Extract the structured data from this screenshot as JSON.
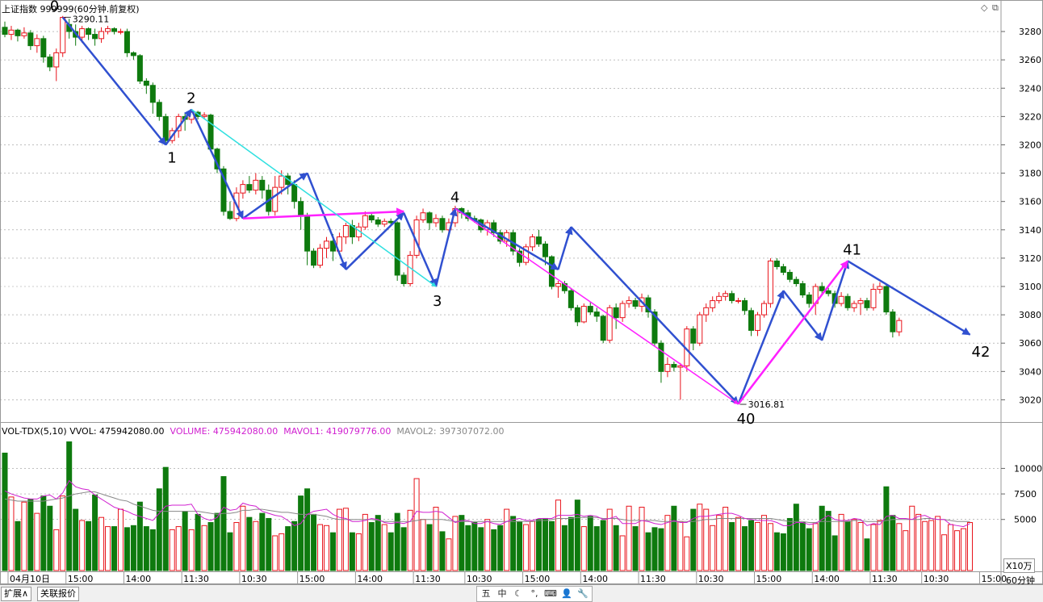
{
  "header": {
    "title": "上证指数",
    "code": "999999(60分钟.前复权)"
  },
  "volume_header": {
    "indicator": "VOL-TDX(5,10)",
    "vvol_label": "VVOL:",
    "vvol_value": "475942080.00",
    "volume_label": "VOLUME:",
    "volume_value": "475942080.00",
    "mavol1_label": "MAVOL1:",
    "mavol1_value": "419079776.00",
    "mavol2_label": "MAVOL2:",
    "mavol2_value": "397307072.00"
  },
  "unit_label": "X10万",
  "period_label": "60分钟",
  "tabs": [
    "扩展∧",
    "关联报价"
  ],
  "tools": [
    "五",
    "中",
    "☾",
    "°,",
    "⌨",
    "👤",
    "🔧"
  ],
  "colors": {
    "up": "#e8141b",
    "down": "#0e7a0e",
    "blue": "#3050d0",
    "magenta": "#ff20ff",
    "cyan": "#30e0e0",
    "mavol1": "#d020d0",
    "mavol2": "#888888"
  },
  "chart_data": {
    "type": "candlestick",
    "price_axis": {
      "ticks": [
        3020,
        3040,
        3060,
        3080,
        3100,
        3120,
        3140,
        3160,
        3180,
        3200,
        3220,
        3240,
        3260,
        3280
      ],
      "range": [
        3006,
        3292
      ]
    },
    "volume_axis": {
      "ticks": [
        5000,
        7500,
        10000
      ],
      "range": [
        0,
        12800
      ]
    },
    "time_labels": [
      {
        "i": 1,
        "t": "04月10日"
      },
      {
        "i": 10,
        "t": "15:00"
      },
      {
        "i": 19,
        "t": "14:00"
      },
      {
        "i": 28,
        "t": "11:30"
      },
      {
        "i": 37,
        "t": "10:30"
      },
      {
        "i": 46,
        "t": "15:00"
      },
      {
        "i": 55,
        "t": "14:00"
      },
      {
        "i": 64,
        "t": "11:30"
      },
      {
        "i": 72,
        "t": "10:30"
      },
      {
        "i": 81,
        "t": "15:00"
      },
      {
        "i": 90,
        "t": "14:00"
      },
      {
        "i": 99,
        "t": "11:30"
      },
      {
        "i": 108,
        "t": "10:30"
      },
      {
        "i": 117,
        "t": "15:00"
      },
      {
        "i": 126,
        "t": "14:00"
      },
      {
        "i": 135,
        "t": "11:30"
      },
      {
        "i": 143,
        "t": "10:30"
      },
      {
        "i": 152,
        "t": "15:00"
      }
    ],
    "candles": [
      [
        3283,
        3278,
        3287,
        3276
      ],
      [
        3278,
        3281,
        3284,
        3274
      ],
      [
        3281,
        3277,
        3282,
        3273
      ],
      [
        3277,
        3279,
        3283,
        3275
      ],
      [
        3279,
        3270,
        3281,
        3267
      ],
      [
        3270,
        3275,
        3278,
        3265
      ],
      [
        3275,
        3262,
        3277,
        3258
      ],
      [
        3262,
        3255,
        3264,
        3252
      ],
      [
        3255,
        3265,
        3268,
        3245
      ],
      [
        3265,
        3290,
        3291,
        3262
      ],
      [
        3285,
        3280,
        3289,
        3275
      ],
      [
        3280,
        3276,
        3285,
        3270
      ],
      [
        3276,
        3282,
        3284,
        3272
      ],
      [
        3282,
        3278,
        3283,
        3274
      ],
      [
        3278,
        3275,
        3282,
        3270
      ],
      [
        3275,
        3280,
        3283,
        3272
      ],
      [
        3280,
        3282,
        3284,
        3278
      ],
      [
        3282,
        3280,
        3283,
        3278
      ],
      [
        3280,
        3280,
        3282,
        3278
      ],
      [
        3280,
        3265,
        3282,
        3262
      ],
      [
        3265,
        3263,
        3266,
        3260
      ],
      [
        3263,
        3245,
        3264,
        3243
      ],
      [
        3245,
        3242,
        3247,
        3236
      ],
      [
        3242,
        3230,
        3244,
        3222
      ],
      [
        3230,
        3220,
        3232,
        3217
      ],
      [
        3220,
        3203,
        3222,
        3200
      ],
      [
        3203,
        3210,
        3212,
        3201
      ],
      [
        3210,
        3220,
        3222,
        3205
      ],
      [
        3220,
        3218,
        3222,
        3210
      ],
      [
        3218,
        3223,
        3225,
        3215
      ],
      [
        3223,
        3220,
        3224,
        3218
      ],
      [
        3220,
        3221,
        3223,
        3218
      ],
      [
        3221,
        3197,
        3222,
        3195
      ],
      [
        3197,
        3183,
        3198,
        3180
      ],
      [
        3183,
        3153,
        3185,
        3150
      ],
      [
        3153,
        3148,
        3160,
        3147
      ],
      [
        3148,
        3166,
        3170,
        3146
      ],
      [
        3166,
        3172,
        3175,
        3162
      ],
      [
        3172,
        3168,
        3178,
        3166
      ],
      [
        3168,
        3175,
        3180,
        3165
      ],
      [
        3175,
        3168,
        3178,
        3162
      ],
      [
        3168,
        3153,
        3172,
        3150
      ],
      [
        3153,
        3170,
        3178,
        3150
      ],
      [
        3170,
        3178,
        3182,
        3165
      ],
      [
        3178,
        3172,
        3180,
        3165
      ],
      [
        3172,
        3160,
        3175,
        3155
      ],
      [
        3160,
        3150,
        3163,
        3140
      ],
      [
        3150,
        3125,
        3152,
        3115
      ],
      [
        3125,
        3115,
        3127,
        3113
      ],
      [
        3115,
        3127,
        3130,
        3113
      ],
      [
        3127,
        3132,
        3135,
        3120
      ],
      [
        3132,
        3125,
        3137,
        3118
      ],
      [
        3125,
        3135,
        3138,
        3122
      ],
      [
        3135,
        3143,
        3145,
        3130
      ],
      [
        3143,
        3135,
        3147,
        3130
      ],
      [
        3135,
        3142,
        3145,
        3132
      ],
      [
        3142,
        3150,
        3153,
        3140
      ],
      [
        3150,
        3147,
        3152,
        3145
      ],
      [
        3147,
        3144,
        3149,
        3142
      ],
      [
        3144,
        3146,
        3148,
        3142
      ],
      [
        3146,
        3145,
        3148,
        3143
      ],
      [
        3145,
        3108,
        3146,
        3104
      ],
      [
        3108,
        3102,
        3110,
        3100
      ],
      [
        3102,
        3122,
        3125,
        3100
      ],
      [
        3122,
        3147,
        3150,
        3120
      ],
      [
        3147,
        3152,
        3155,
        3145
      ],
      [
        3152,
        3145,
        3153,
        3140
      ],
      [
        3145,
        3148,
        3151,
        3142
      ],
      [
        3148,
        3140,
        3150,
        3138
      ],
      [
        3140,
        3145,
        3148,
        3135
      ],
      [
        3145,
        3155,
        3157,
        3142
      ],
      [
        3155,
        3152,
        3156,
        3148
      ],
      [
        3152,
        3148,
        3154,
        3146
      ],
      [
        3148,
        3147,
        3150,
        3145
      ],
      [
        3147,
        3140,
        3148,
        3138
      ],
      [
        3140,
        3145,
        3147,
        3136
      ],
      [
        3145,
        3138,
        3147,
        3135
      ],
      [
        3138,
        3132,
        3140,
        3130
      ],
      [
        3132,
        3138,
        3140,
        3128
      ],
      [
        3138,
        3125,
        3140,
        3122
      ],
      [
        3125,
        3117,
        3127,
        3114
      ],
      [
        3117,
        3128,
        3130,
        3115
      ],
      [
        3128,
        3135,
        3137,
        3125
      ],
      [
        3135,
        3130,
        3140,
        3128
      ],
      [
        3130,
        3121,
        3132,
        3115
      ],
      [
        3121,
        3100,
        3122,
        3098
      ],
      [
        3100,
        3102,
        3104,
        3092
      ],
      [
        3102,
        3097,
        3104,
        3095
      ],
      [
        3097,
        3085,
        3099,
        3083
      ],
      [
        3085,
        3075,
        3087,
        3072
      ],
      [
        3075,
        3086,
        3088,
        3074
      ],
      [
        3086,
        3082,
        3089,
        3080
      ],
      [
        3082,
        3079,
        3085,
        3075
      ],
      [
        3079,
        3062,
        3080,
        3060
      ],
      [
        3062,
        3085,
        3087,
        3060
      ],
      [
        3085,
        3078,
        3088,
        3070
      ],
      [
        3078,
        3088,
        3090,
        3075
      ],
      [
        3088,
        3090,
        3093,
        3085
      ],
      [
        3090,
        3086,
        3092,
        3084
      ],
      [
        3086,
        3092,
        3095,
        3082
      ],
      [
        3092,
        3082,
        3094,
        3078
      ],
      [
        3082,
        3060,
        3084,
        3058
      ],
      [
        3060,
        3040,
        3062,
        3032
      ],
      [
        3040,
        3045,
        3050,
        3036
      ],
      [
        3045,
        3043,
        3047,
        3040
      ],
      [
        3043,
        3044,
        3046,
        3020
      ],
      [
        3044,
        3070,
        3072,
        3040
      ],
      [
        3070,
        3060,
        3072,
        3055
      ],
      [
        3060,
        3080,
        3082,
        3058
      ],
      [
        3080,
        3085,
        3088,
        3075
      ],
      [
        3085,
        3090,
        3093,
        3082
      ],
      [
        3090,
        3093,
        3096,
        3088
      ],
      [
        3093,
        3095,
        3097,
        3090
      ],
      [
        3095,
        3090,
        3097,
        3088
      ],
      [
        3090,
        3090,
        3092,
        3088
      ],
      [
        3090,
        3083,
        3092,
        3080
      ],
      [
        3083,
        3069,
        3085,
        3065
      ],
      [
        3069,
        3080,
        3082,
        3065
      ],
      [
        3080,
        3088,
        3090,
        3078
      ],
      [
        3088,
        3118,
        3120,
        3085
      ],
      [
        3118,
        3114,
        3120,
        3112
      ],
      [
        3114,
        3110,
        3116,
        3108
      ],
      [
        3110,
        3105,
        3112,
        3103
      ],
      [
        3105,
        3102,
        3107,
        3100
      ],
      [
        3102,
        3094,
        3104,
        3092
      ],
      [
        3094,
        3088,
        3096,
        3085
      ],
      [
        3088,
        3100,
        3102,
        3080
      ],
      [
        3100,
        3097,
        3103,
        3095
      ],
      [
        3097,
        3095,
        3099,
        3093
      ],
      [
        3095,
        3088,
        3097,
        3085
      ],
      [
        3088,
        3093,
        3096,
        3086
      ],
      [
        3093,
        3085,
        3095,
        3083
      ],
      [
        3085,
        3088,
        3090,
        3082
      ],
      [
        3088,
        3090,
        3092,
        3080
      ],
      [
        3090,
        3085,
        3092,
        3083
      ],
      [
        3085,
        3098,
        3102,
        3083
      ],
      [
        3098,
        3100,
        3103,
        3095
      ],
      [
        3100,
        3082,
        3101,
        3080
      ],
      [
        3082,
        3068,
        3084,
        3064
      ],
      [
        3068,
        3076,
        3078,
        3065
      ]
    ],
    "volumes": [
      11500,
      7200,
      4800,
      6700,
      7000,
      5600,
      7300,
      6300,
      4000,
      7300,
      12600,
      6000,
      4900,
      4800,
      7400,
      5200,
      4300,
      4300,
      6000,
      4200,
      4400,
      6700,
      4300,
      4000,
      8000,
      10100,
      4000,
      4300,
      5800,
      4000,
      5500,
      4400,
      4700,
      5600,
      9200,
      3700,
      4700,
      6300,
      5200,
      4800,
      5600,
      5100,
      3400,
      3600,
      4300,
      4800,
      7300,
      8000,
      5500,
      4500,
      4400,
      3700,
      6000,
      6100,
      3700,
      3600,
      5500,
      4700,
      5400,
      4500,
      3700,
      5600,
      4200,
      5900,
      9000,
      5000,
      4500,
      6200,
      3800,
      3100,
      5300,
      5400,
      4400,
      4700,
      4200,
      5000,
      4000,
      4400,
      6000,
      5300,
      4800,
      4500,
      4800,
      5000,
      5100,
      4800,
      6900,
      4400,
      5200,
      6900,
      4300,
      5300,
      4300,
      4900,
      6000,
      4400,
      3400,
      6300,
      4300,
      6200,
      3700,
      4200,
      4100,
      5400,
      6300,
      4800,
      3300,
      6000,
      6500,
      6000,
      4400,
      5400,
      6200,
      4700,
      5200,
      4300,
      4900,
      4700,
      5400,
      4600,
      3700,
      3600,
      5100,
      6500,
      4700,
      4100,
      4600,
      6300,
      5800,
      3400,
      5500,
      4800,
      5000,
      4700,
      3100,
      4500,
      4900,
      8200,
      5400,
      4600,
      3900,
      6300,
      5500,
      4800,
      4900,
      5300,
      3500,
      4500,
      3900,
      4100,
      4700
    ],
    "mavol1": [
      7800,
      7500,
      7300,
      7100,
      7000,
      7000,
      7300,
      7400,
      7000,
      7600,
      8800,
      8200,
      8000,
      7900,
      7400,
      7000,
      6600,
      6200,
      6000,
      5800,
      5500,
      5300,
      5100,
      4900,
      5600,
      6300,
      6400,
      6400,
      6400,
      6500,
      5500,
      5100,
      4900,
      5200,
      6200,
      5900,
      6000,
      6600,
      6400,
      6300,
      5800,
      5600,
      5400,
      5300,
      4900,
      4400,
      4600,
      5500,
      5800,
      5900,
      6000,
      5500,
      5200,
      5100,
      4800,
      4800,
      4900,
      5100,
      5000,
      4700,
      4600,
      4700,
      4600,
      4800,
      5800,
      5700,
      5700,
      5800,
      5700,
      5200,
      4700,
      4900,
      4900,
      4600,
      4600,
      4800,
      4600,
      4500,
      4800,
      5000,
      5100,
      4900,
      4900,
      5100,
      5100,
      5100,
      5400,
      5400,
      5400,
      5500,
      5300,
      5400,
      5300,
      5000,
      5100,
      5300,
      4600,
      4600,
      4600,
      4900,
      4800,
      4600,
      4500,
      4700,
      4900,
      4700,
      4700,
      5100,
      5300,
      5300,
      5400,
      5500,
      5600,
      5600,
      5400,
      5100,
      5000,
      4900,
      4900,
      4900,
      4700,
      4400,
      4400,
      4700,
      4700,
      4500,
      4600,
      5000,
      5400,
      5000,
      4900,
      4900,
      5100,
      5000,
      4400,
      4600,
      4500,
      5300,
      5400,
      5100,
      5100,
      5000,
      5300,
      5400,
      5100,
      5000,
      5000,
      4500,
      4400,
      4300,
      4600
    ],
    "mavol2": [
      7000,
      6900,
      6800,
      6800,
      6800,
      6800,
      6800,
      6900,
      7000,
      7100,
      7300,
      7500,
      7600,
      7700,
      7700,
      7500,
      7300,
      7100,
      6900,
      6800,
      6500,
      6300,
      6100,
      5900,
      5800,
      5800,
      5800,
      5800,
      5800,
      5800,
      5800,
      5700,
      5600,
      5500,
      5600,
      5600,
      5700,
      5900,
      5900,
      6000,
      6000,
      5900,
      5800,
      5700,
      5700,
      5600,
      5500,
      5500,
      5500,
      5400,
      5300,
      5100,
      5000,
      5000,
      5000,
      5000,
      5000,
      5000,
      4900,
      4800,
      4800,
      4800,
      4800,
      4800,
      4900,
      5000,
      5000,
      5000,
      5000,
      4900,
      4800,
      4800,
      4800,
      4800,
      4800,
      4800,
      4800,
      4800,
      4800,
      4800,
      4800,
      4800,
      4800,
      4900,
      4900,
      5000,
      5100,
      5100,
      5100,
      5200,
      5200,
      5200,
      5200,
      5100,
      5100,
      5100,
      5000,
      4900,
      4900,
      4900,
      4900,
      4900,
      4800,
      4800,
      4800,
      4800,
      4800,
      4800,
      4900,
      5000,
      5000,
      5100,
      5100,
      5100,
      5100,
      5100,
      5100,
      5100,
      5100,
      5100,
      5000,
      4900,
      4800,
      4800,
      4800,
      4700,
      4700,
      4800,
      4800,
      4800,
      4800,
      4800,
      4900,
      4900,
      4800,
      4800,
      4800,
      4900,
      5000,
      5000,
      5000,
      5000,
      5000,
      5100,
      5100,
      5000,
      5000,
      4900,
      4800,
      4800,
      4800
    ],
    "wave_labels": [
      {
        "label": "0",
        "i": 9,
        "price": 3290
      },
      {
        "label": "1",
        "i": 25,
        "price": 3200
      },
      {
        "label": "2",
        "i": 29,
        "price": 3225
      },
      {
        "label": "3",
        "i": 61,
        "price": 3100
      },
      {
        "label": "4",
        "i": 63,
        "price": 3155
      },
      {
        "label": "40",
        "i": 104,
        "price": 3016.81
      },
      {
        "label": "41",
        "i": 119,
        "price": 3118
      },
      {
        "label": "42",
        "i": 136,
        "price": 3064
      }
    ],
    "price_annotations": [
      {
        "text": "3290.11",
        "i": 9,
        "price": 3290.11
      },
      {
        "text": "3016.81",
        "i": 104,
        "price": 3016.81
      }
    ]
  }
}
